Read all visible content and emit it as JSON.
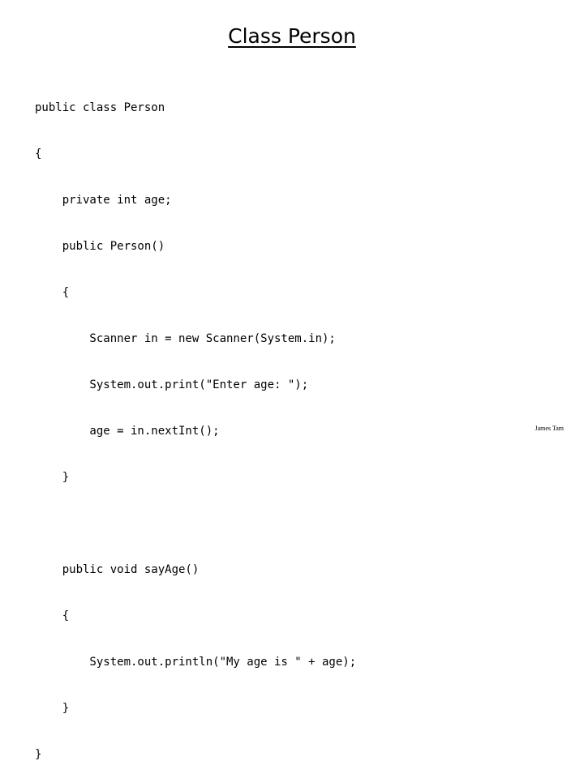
{
  "slide": {
    "title": "Class Person",
    "code_lines": [
      "public class Person",
      "{",
      "    private int age;",
      "    public Person()",
      "    {",
      "        Scanner in = new Scanner(System.in);",
      "        System.out.print(\"Enter age: \");",
      "        age = in.nextInt();",
      "    }",
      "",
      "    public void sayAge()",
      "    {",
      "        System.out.println(\"My age is \" + age);",
      "    }",
      "}"
    ],
    "footer": "James Tam"
  }
}
